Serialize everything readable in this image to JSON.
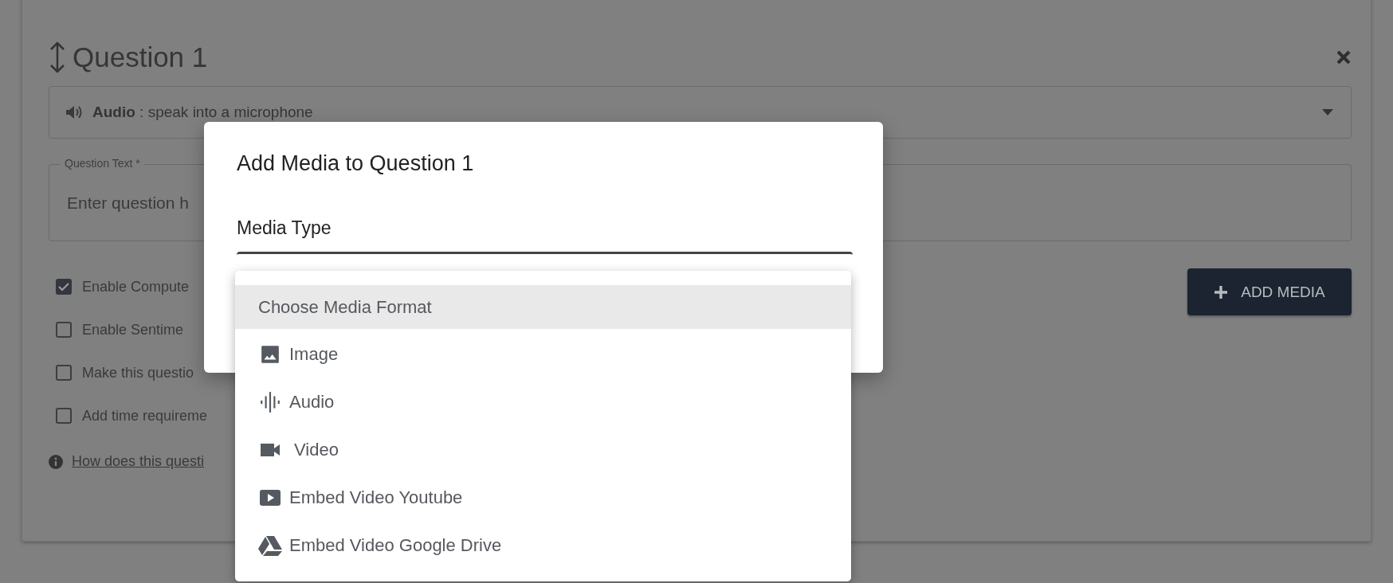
{
  "question_card": {
    "title": "Question 1",
    "answer_type": {
      "text": "**Audio** : speak into a microphone"
    },
    "question_text": {
      "label": "Question Text *",
      "placeholder": "Enter question h"
    },
    "options": [
      {
        "label": "Enable Compute",
        "checked": true
      },
      {
        "label": "Enable Sentime",
        "checked": false
      },
      {
        "label": "Make this questio",
        "checked": false
      },
      {
        "label": "Add time requireme",
        "checked": false
      }
    ],
    "help_link": "How does this questi",
    "add_media_button": "ADD MEDIA"
  },
  "modal": {
    "title": "Add Media to Question 1",
    "field_label": "Media Type",
    "menu": [
      {
        "kind": "placeholder",
        "label": "Choose Media Format",
        "selected": true
      },
      {
        "kind": "image",
        "label": "Image",
        "selected": false
      },
      {
        "kind": "audio",
        "label": "Audio",
        "selected": false
      },
      {
        "kind": "video",
        "label": "Video",
        "selected": false
      },
      {
        "kind": "youtube",
        "label": "Embed Video Youtube",
        "selected": false
      },
      {
        "kind": "drive",
        "label": "Embed Video Google Drive",
        "selected": false
      }
    ]
  }
}
